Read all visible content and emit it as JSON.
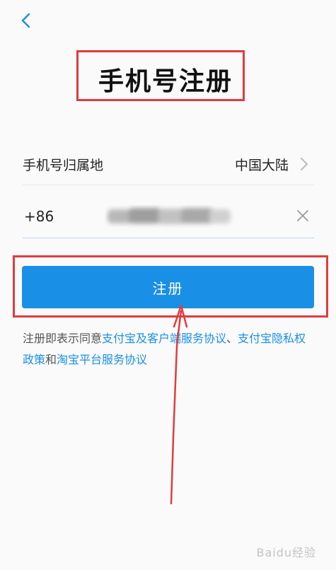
{
  "header": {
    "back_icon": "chevron-left-icon",
    "title": "手机号注册"
  },
  "region": {
    "label": "手机号归属地",
    "value": "中国大陆",
    "icon": "chevron-right-icon"
  },
  "phone": {
    "country_code": "+86",
    "value": "",
    "clear_icon": "close-icon"
  },
  "register_button": {
    "label": "注册"
  },
  "agreement": {
    "prefix": "注册即表示同意",
    "link1": "支付宝及客户端服务协议",
    "sep": "、",
    "link2": "支付宝隐私权政策",
    "conj": "和",
    "link3": "淘宝平台服务协议"
  },
  "watermark": {
    "text": "Baidu经验"
  },
  "colors": {
    "accent": "#1a8fe6",
    "annotation": "#e03c3c"
  }
}
